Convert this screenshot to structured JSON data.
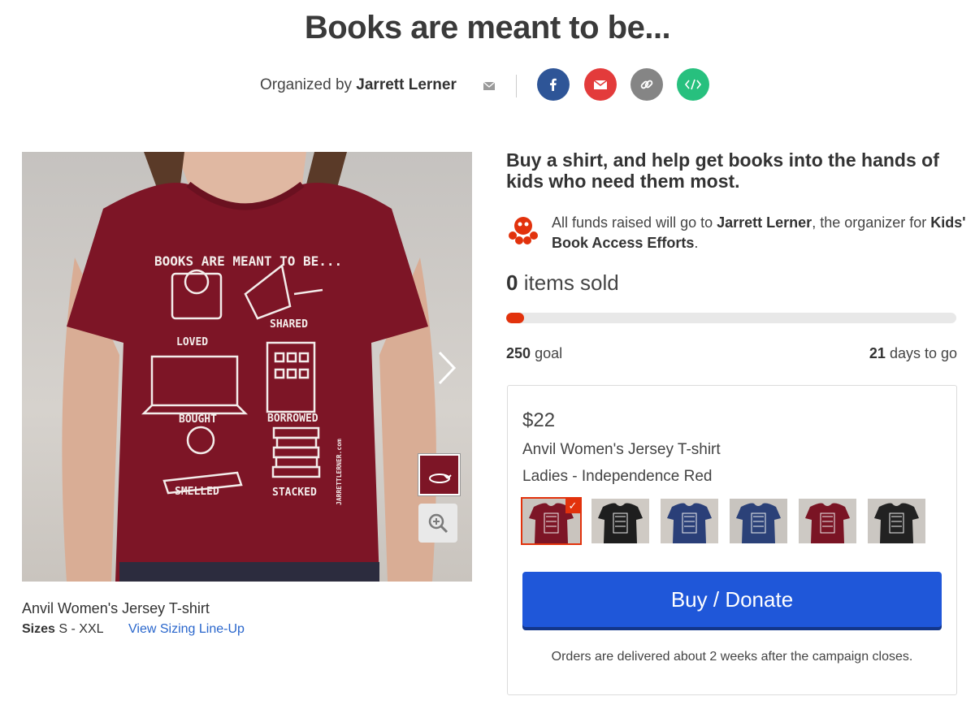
{
  "header": {
    "title": "Books are meant to be...",
    "organized_by_prefix": "Organized by",
    "organizer_name": "Jarrett Lerner"
  },
  "share_buttons": [
    {
      "name": "facebook",
      "icon": "facebook-icon",
      "color": "#2e5597"
    },
    {
      "name": "email",
      "icon": "envelope-icon",
      "color": "#e33b3b"
    },
    {
      "name": "link",
      "icon": "link-icon",
      "color": "#858585"
    },
    {
      "name": "embed",
      "icon": "code-icon",
      "color": "#27c07e"
    }
  ],
  "gallery": {
    "shirt_text": {
      "headline": "BOOKS ARE MEANT TO BE...",
      "captions": [
        "LOVED",
        "SHARED",
        "BOUGHT",
        "BORROWED",
        "SMELLED",
        "STACKED"
      ],
      "signature": "JARRETTLERNER.com"
    },
    "product_name": "Anvil Women's Jersey T-shirt",
    "sizes_label": "Sizes",
    "sizes_value": "S - XXL",
    "sizing_link": "View Sizing Line-Up"
  },
  "campaign": {
    "tagline": "Buy a shirt, and help get books into the hands of kids who need them most.",
    "funds_prefix": "All funds raised will go to",
    "funds_recipient": "Jarrett Lerner",
    "funds_middle": ", the organizer for",
    "funds_cause": "Kids' Book Access Efforts",
    "funds_suffix": ".",
    "items_sold_count": "0",
    "items_sold_label": "items sold",
    "progress_fraction": 0,
    "goal_count": "250",
    "goal_label": "goal",
    "days_count": "21",
    "days_label": "days to go",
    "accent_color": "#e2320c"
  },
  "purchase": {
    "price": "$22",
    "product_name": "Anvil Women's Jersey T-shirt",
    "color_label": "Ladies - Independence Red",
    "swatches": [
      {
        "color": "#7d1526",
        "bg": "#c9c4be",
        "selected": true
      },
      {
        "color": "#1e1e1e",
        "bg": "#cfcac4",
        "selected": false
      },
      {
        "color": "#2a3f78",
        "bg": "#cfcac4",
        "selected": false
      },
      {
        "color": "#2b4178",
        "bg": "#c8c4bf",
        "selected": false
      },
      {
        "color": "#7a1424",
        "bg": "#cdc9c4",
        "selected": false
      },
      {
        "color": "#222222",
        "bg": "#cbc7c2",
        "selected": false
      }
    ],
    "button_label": "Buy / Donate",
    "button_color": "#1f57d9",
    "delivery_note": "Orders are delivered about 2 weeks after the campaign closes."
  }
}
